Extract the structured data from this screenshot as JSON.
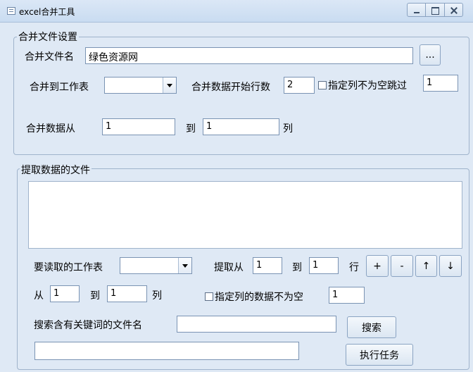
{
  "window": {
    "title": "excel合并工具"
  },
  "merge_settings": {
    "legend": "合并文件设置",
    "file_name_label": "合并文件名",
    "file_name_value": "绿色资源网",
    "browse_label": "...",
    "merge_to_sheet_label": "合并到工作表",
    "merge_to_sheet_value": "",
    "start_row_label": "合并数据开始行数",
    "start_row_value": "2",
    "skip_empty_label": "指定列不为空跳过",
    "skip_empty_value": "1",
    "merge_from_label": "合并数据从",
    "merge_from_value": "1",
    "to_label": "到",
    "merge_to_value": "1",
    "column_label": "列"
  },
  "extract": {
    "legend": "提取数据的文件",
    "sheet_label": "要读取的工作表",
    "sheet_value": "",
    "extract_from_label": "提取从",
    "extract_from_value": "1",
    "to_label": "到",
    "extract_to_value": "1",
    "row_label": "行",
    "add_label": "+",
    "remove_label": "-",
    "up_label": "↑",
    "down_label": "↓",
    "col_from_label": "从",
    "col_from_value": "1",
    "col_to_label": "到",
    "col_to_value": "1",
    "col_label": "列",
    "not_empty_label": "指定列的数据不为空",
    "not_empty_value": "1",
    "search_label": "搜索含有关键词的文件名",
    "search_value": "",
    "search_button": "搜索",
    "status_value": "",
    "run_button": "执行任务"
  }
}
